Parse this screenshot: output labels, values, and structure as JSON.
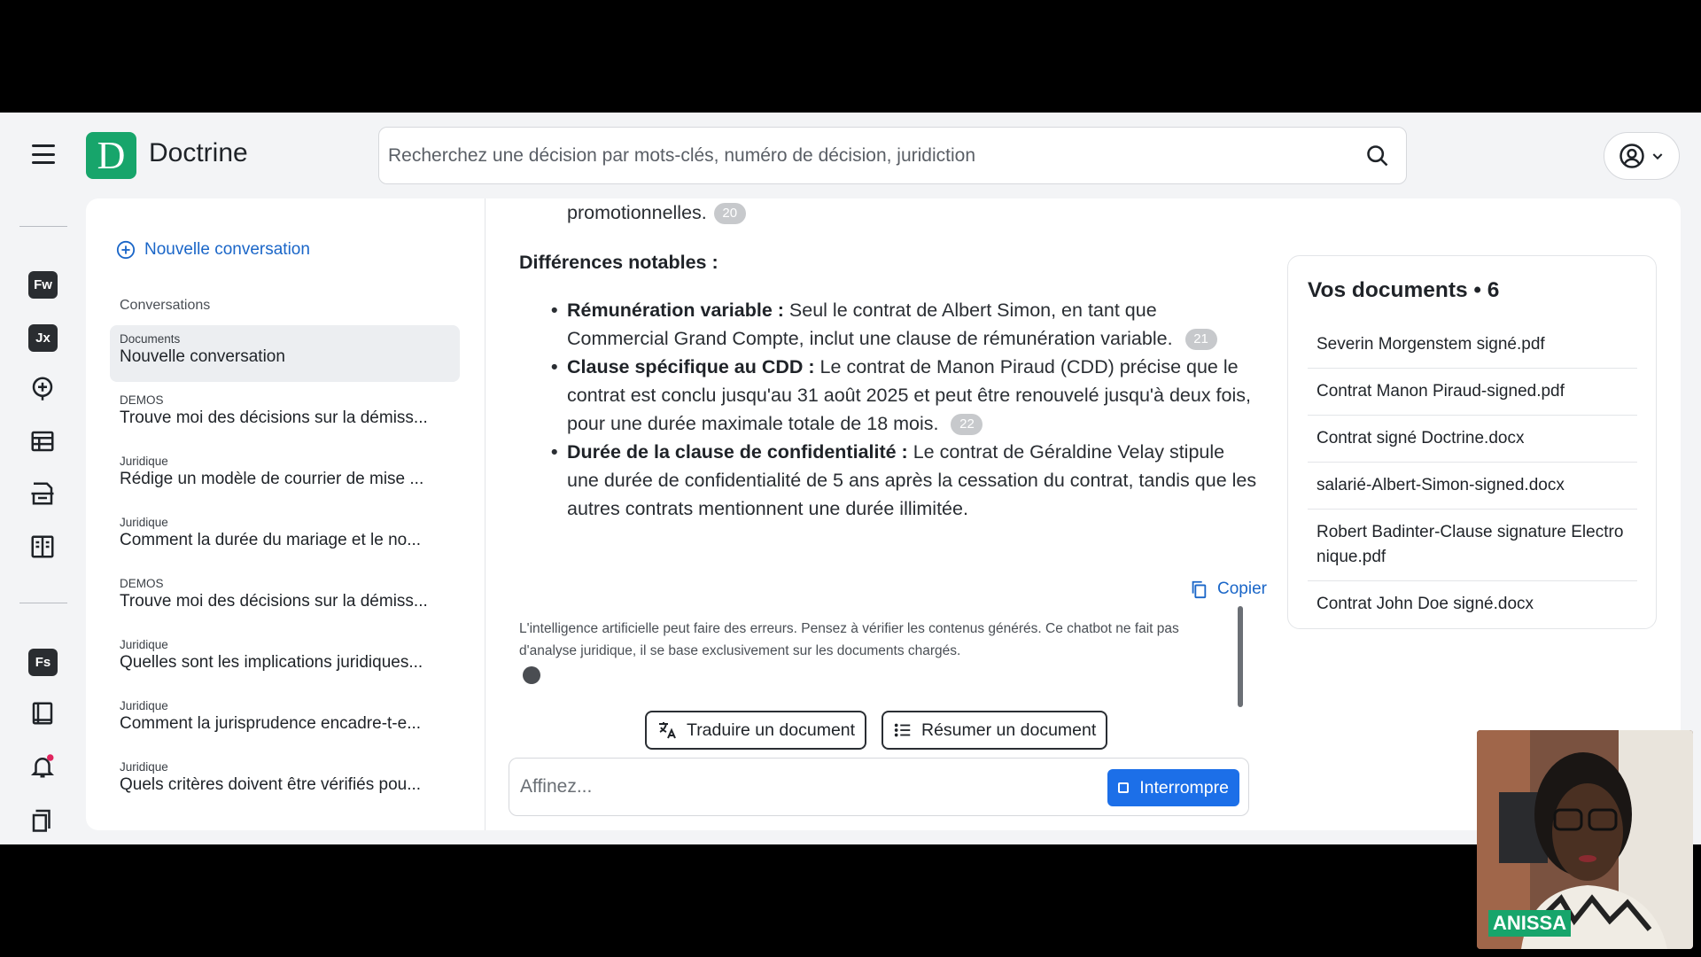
{
  "header": {
    "brand_letter": "D",
    "brand_name": "Doctrine",
    "search_placeholder": "Recherchez une décision par mots-clés, numéro de décision, juridiction"
  },
  "rail": {
    "badges": [
      "Fw",
      "Jx",
      "Fs"
    ]
  },
  "sidebar": {
    "new_conversation": "Nouvelle conversation",
    "heading": "Conversations",
    "items": [
      {
        "category": "Documents",
        "title": "Nouvelle conversation",
        "active": true
      },
      {
        "category": "DEMOS",
        "title": "Trouve moi des décisions sur la démiss..."
      },
      {
        "category": "Juridique",
        "title": "Rédige un modèle de courrier de mise ..."
      },
      {
        "category": "Juridique",
        "title": "Comment la durée du mariage et le no..."
      },
      {
        "category": "DEMOS",
        "title": "Trouve moi des décisions sur la démiss..."
      },
      {
        "category": "Juridique",
        "title": "Quelles sont les implications juridiques..."
      },
      {
        "category": "Juridique",
        "title": "Comment la jurisprudence encadre-t-e..."
      },
      {
        "category": "Juridique",
        "title": "Quels critères doivent être vérifiés pou..."
      }
    ]
  },
  "chat": {
    "line1": "promotionnelles.",
    "line1_cite": "20",
    "diff_title": "Différences notables :",
    "bullets": [
      {
        "bold": "Rémunération variable :",
        "text": " Seul le contrat de Albert Simon, en tant que Commercial Grand Compte, inclut une clause de rémunération variable.",
        "cite": "21"
      },
      {
        "bold": "Clause spécifique au CDD :",
        "text": " Le contrat de Manon Piraud (CDD) précise que le contrat est conclu jusqu'au 31 août 2025 et peut être renouvelé jusqu'à deux fois, pour une durée maximale totale de 18 mois.",
        "cite": "22"
      },
      {
        "bold": "Durée de la clause de confidentialité :",
        "text": " Le contrat de Géraldine Velay stipule une durée de confidentialité de 5 ans après la cessation du contrat, tandis que les autres contrats mentionnent une durée illimitée.",
        "cite": ""
      }
    ],
    "copy_label": "Copier",
    "disclaimer": "L'intelligence artificielle peut faire des erreurs. Pensez à vérifier les contenus générés. Ce chatbot ne fait pas d'analyse juridique, il se base exclusivement sur les documents chargés.",
    "translate_label": "Traduire un document",
    "summarize_label": "Résumer un document",
    "composer_placeholder": "Affinez...",
    "stop_label": "Interrompre"
  },
  "documents": {
    "title": "Vos documents • 6",
    "items": [
      "Severin Morgenstem signé.pdf",
      "Contrat Manon Piraud-signed.pdf",
      "Contrat signé Doctrine.docx",
      "salarié-Albert-Simon-signed.docx",
      "Robert Badinter-Clause signature Electronique.pdf",
      "Contrat John Doe signé.docx"
    ]
  },
  "webcam": {
    "name": "ANISSA"
  },
  "colors": {
    "brand": "#17a56b",
    "accent": "#1a66c8",
    "primary_button": "#1c6fe8"
  }
}
